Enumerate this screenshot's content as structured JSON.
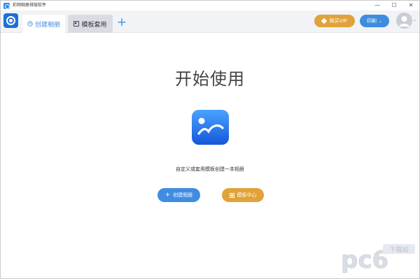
{
  "window": {
    "title": "彩网相册排版软件",
    "controls": {
      "minimize": "—",
      "maximize": "☐",
      "close": "✕"
    }
  },
  "tabs": [
    {
      "label": "创建相册",
      "icon": "clock-icon",
      "active": true
    },
    {
      "label": "模板套用",
      "icon": "template-icon",
      "active": false
    }
  ],
  "tabbar": {
    "add_label": "+"
  },
  "header": {
    "vip_label": "购买VIP",
    "print_label": "印刷",
    "print_chevron": "⌄",
    "avatar_chevron": "⌄"
  },
  "main": {
    "title": "开始使用",
    "subtitle": "自定义或套用模板创建一本相册",
    "create_button": {
      "label": "创建相册",
      "icon": "+"
    },
    "template_button": {
      "label": "模板中心"
    }
  },
  "watermark": {
    "brand": "pc6",
    "label": "下载站"
  },
  "colors": {
    "accent_blue": "#3f8de0",
    "logo_blue": "#1e6fd6",
    "accent_gold": "#e1a23a",
    "tabbar_bg": "#f1f3f6"
  }
}
